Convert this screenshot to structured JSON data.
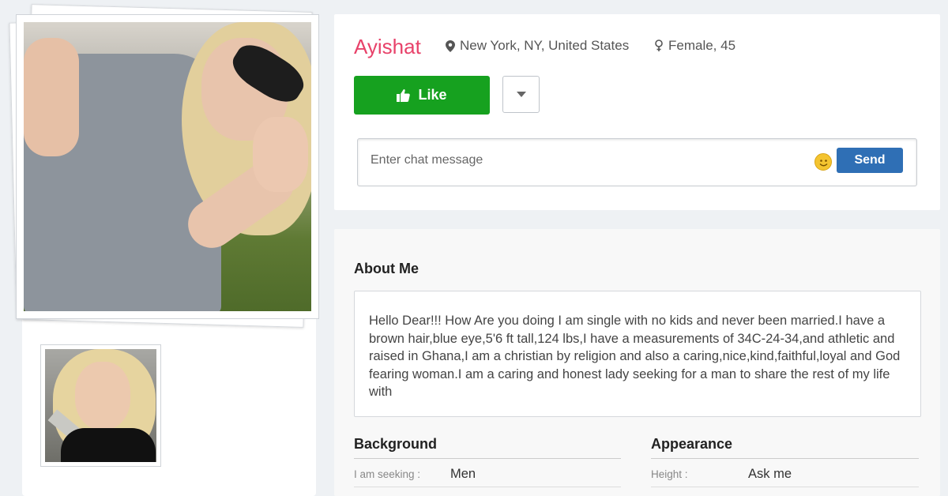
{
  "profile": {
    "name": "Ayishat",
    "location": "New York, NY, United States",
    "gender_age": "Female, 45",
    "location_icon": "map-pin-icon",
    "gender_icon": "female-symbol-icon"
  },
  "actions": {
    "like_label": "Like",
    "like_icon": "thumbs-up-icon",
    "more_icon": "caret-down-icon",
    "like_color": "#16a11f"
  },
  "chat": {
    "placeholder": "Enter chat message",
    "send_label": "Send",
    "emoji_icon": "smiley-icon",
    "send_color": "#2f6fb5"
  },
  "about": {
    "title": "About Me",
    "text": "Hello Dear!!! How Are you doing I am single with no kids and never been married.I have a brown hair,blue eye,5'6 ft tall,124 lbs,I have a measurements of 34C-24-34,and athletic and raised in Ghana,I am a christian by religion and also a caring,nice,kind,faithful,loyal and God fearing woman.I am a caring and honest lady seeking for a man to share the rest of my life with"
  },
  "background": {
    "title": "Background",
    "seeking_label": "I am seeking :",
    "seeking_value": "Men"
  },
  "appearance": {
    "title": "Appearance",
    "height_label": "Height :",
    "height_value": "Ask me"
  },
  "photos": {
    "main_alt": "profile-photo-main",
    "thumb_alt": "profile-photo-thumbnail"
  },
  "colors": {
    "name": "#e8426a",
    "page_bg": "#eef1f4"
  }
}
